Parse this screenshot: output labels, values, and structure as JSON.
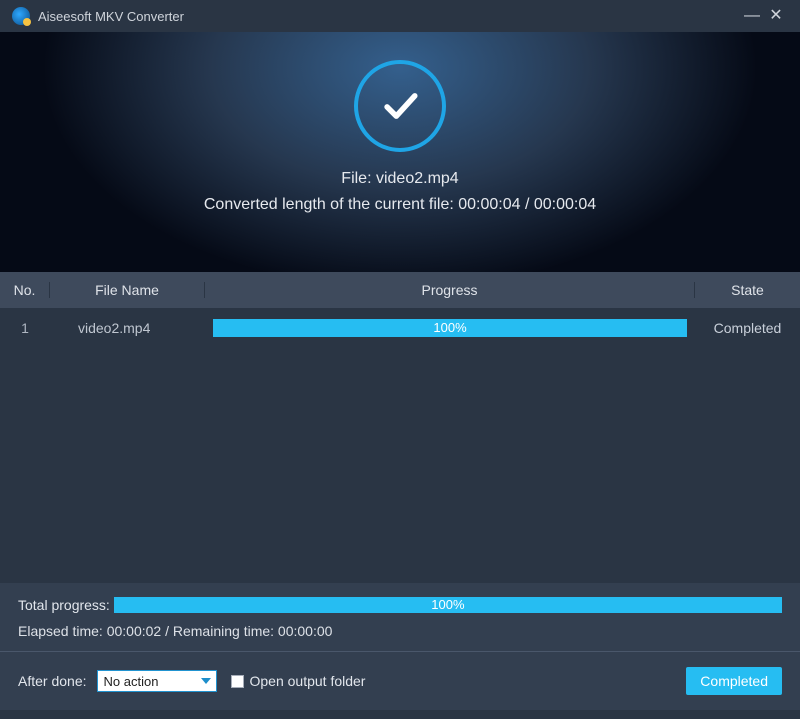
{
  "window": {
    "title": "Aiseesoft MKV Converter"
  },
  "hero": {
    "file_label": "File: video2.mp4",
    "progress_text": "Converted length of the current file: 00:00:04 / 00:00:04"
  },
  "table": {
    "headers": {
      "no": "No.",
      "file_name": "File Name",
      "progress": "Progress",
      "state": "State"
    },
    "rows": [
      {
        "no": "1",
        "file_name": "video2.mp4",
        "progress_percent": "100%",
        "progress_value": 100,
        "state": "Completed"
      }
    ]
  },
  "footer": {
    "total_label": "Total progress:",
    "total_percent": "100%",
    "total_value": 100,
    "times_text": "Elapsed time: 00:00:02 / Remaining time: 00:00:00",
    "after_done_label": "After done:",
    "after_done_value": "No action",
    "open_folder_label": "Open output folder",
    "button_label": "Completed"
  }
}
